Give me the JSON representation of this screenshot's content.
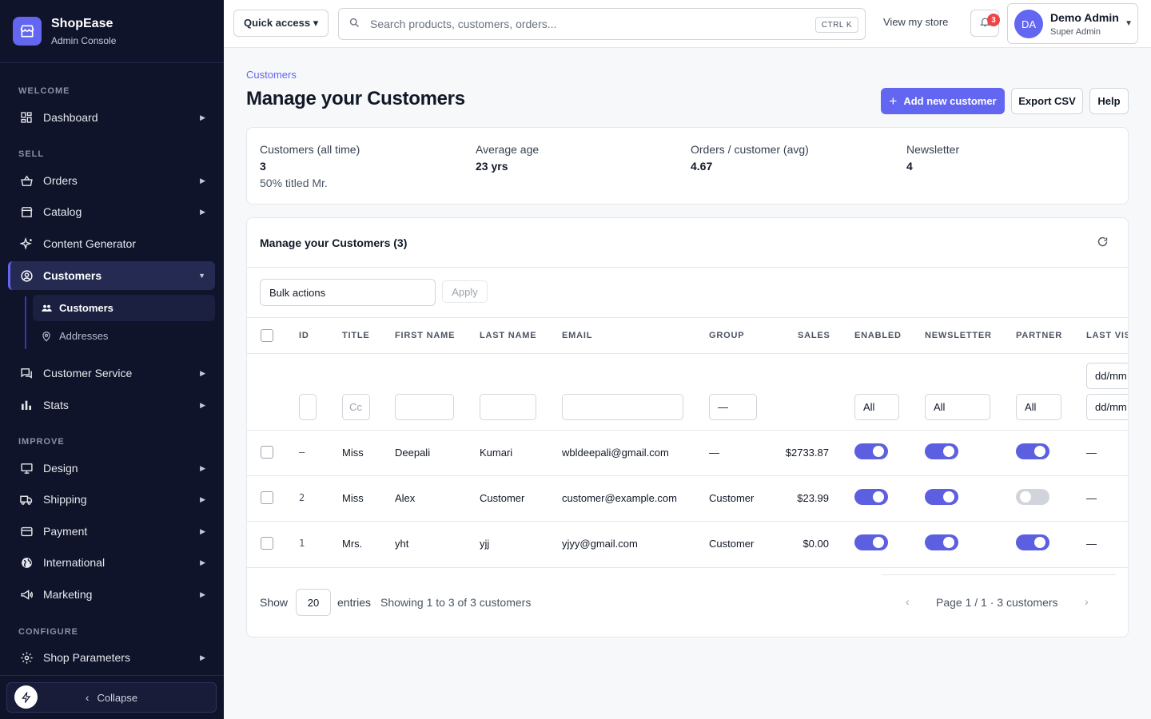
{
  "brand": {
    "name": "ShopEase",
    "subtitle": "Admin Console"
  },
  "sidebar": {
    "sections": [
      "WELCOME",
      "SELL",
      "IMPROVE",
      "CONFIGURE"
    ],
    "items": [
      {
        "label": "Dashboard",
        "icon": "dashboard-icon"
      },
      {
        "label": "Orders",
        "icon": "basket-icon"
      },
      {
        "label": "Catalog",
        "icon": "store-icon"
      },
      {
        "label": "Content Generator",
        "icon": "sparkles-icon"
      },
      {
        "label": "Customers",
        "icon": "user-circle-icon",
        "active": true
      },
      {
        "label": "Customer Service",
        "icon": "chat-icon"
      },
      {
        "label": "Stats",
        "icon": "bar-chart-icon"
      },
      {
        "label": "Design",
        "icon": "monitor-icon"
      },
      {
        "label": "Shipping",
        "icon": "truck-icon"
      },
      {
        "label": "Payment",
        "icon": "credit-card-icon"
      },
      {
        "label": "International",
        "icon": "globe-icon"
      },
      {
        "label": "Marketing",
        "icon": "megaphone-icon"
      },
      {
        "label": "Shop Parameters",
        "icon": "gear-icon"
      }
    ],
    "sub_items": [
      {
        "label": "Customers",
        "icon": "users-icon",
        "active": true
      },
      {
        "label": "Addresses",
        "icon": "map-pin-icon"
      }
    ],
    "collapse_label": "Collapse"
  },
  "topbar": {
    "quick_access": "Quick access ▾",
    "search_placeholder": "Search products, customers, orders...",
    "shortcut": "CTRL K",
    "view_store": "View my store",
    "notifications": "3",
    "user": {
      "initials": "DA",
      "name": "Demo Admin",
      "role": "Super Admin"
    }
  },
  "page": {
    "breadcrumb": "Customers",
    "title": "Manage your Customers",
    "add_button": "Add new customer",
    "export_button": "Export CSV",
    "help_button": "Help"
  },
  "stats": [
    {
      "label": "Customers (all time)",
      "value": "3",
      "note": "50% titled Mr."
    },
    {
      "label": "Average age",
      "value": "23 yrs"
    },
    {
      "label": "Orders / customer (avg)",
      "value": "4.67"
    },
    {
      "label": "Newsletter",
      "value": "4"
    }
  ],
  "table": {
    "title": "Manage your Customers (3)",
    "bulk_actions": "Bulk actions",
    "apply": "Apply",
    "columns": [
      "ID",
      "TITLE",
      "FIRST NAME",
      "LAST NAME",
      "EMAIL",
      "GROUP",
      "SALES",
      "ENABLED",
      "NEWSLETTER",
      "PARTNER",
      "LAST VIS"
    ],
    "filters": {
      "title_placeholder": "Cc",
      "group": "—",
      "enabled": "All",
      "newsletter": "All",
      "partner": "All",
      "date_from": "dd/mm",
      "date_to": "dd/mm"
    },
    "rows": [
      {
        "id": "–",
        "title": "Miss",
        "first": "Deepali",
        "last": "Kumari",
        "email": "wbldeepali@gmail.com",
        "group": "—",
        "sales": "$2733.87",
        "enabled": true,
        "newsletter": true,
        "partner": true,
        "last_visit": "—"
      },
      {
        "id": "2",
        "title": "Miss",
        "first": "Alex",
        "last": "Customer",
        "email": "customer@example.com",
        "group": "Customer",
        "sales": "$23.99",
        "enabled": true,
        "newsletter": true,
        "partner": false,
        "last_visit": "—"
      },
      {
        "id": "1",
        "title": "Mrs.",
        "first": "yht",
        "last": "yjj",
        "email": "yjyy@gmail.com",
        "group": "Customer",
        "sales": "$0.00",
        "enabled": true,
        "newsletter": true,
        "partner": true,
        "last_visit": "—"
      }
    ],
    "footer": {
      "show": "Show",
      "per_page": "20",
      "entries": "entries",
      "showing": "Showing 1 to 3 of 3 customers",
      "page_info": "Page 1 / 1 · 3 customers"
    }
  },
  "colors": {
    "accent": "#6366f1",
    "sidebar_bg": "#10142a",
    "toggle_on": "#5b5fe0",
    "toggle_off": "#d1d5db",
    "badge": "#ef4444"
  }
}
